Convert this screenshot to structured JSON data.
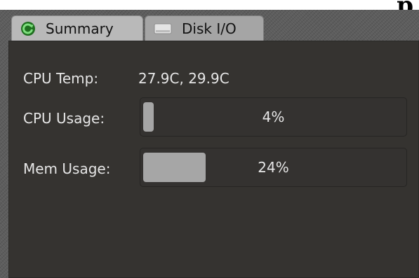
{
  "background_text": "p",
  "tabs": [
    {
      "label": "Summary",
      "icon": "refresh-icon",
      "active": true
    },
    {
      "label": "Disk I/O",
      "icon": "drive-icon",
      "active": false
    }
  ],
  "cpu_temp": {
    "label": "CPU Temp:",
    "value": "27.9C, 29.9C"
  },
  "cpu_usage": {
    "label": "CPU Usage:",
    "value": "4%",
    "fraction": 0.04
  },
  "mem_usage": {
    "label": "Mem Usage:",
    "value": "24%",
    "fraction": 0.24
  },
  "colors": {
    "panel": "#353330",
    "bar_fill": "#a6a6a6",
    "tab_active": "#b9b9b9",
    "icon_green": "#3a9a3a"
  }
}
